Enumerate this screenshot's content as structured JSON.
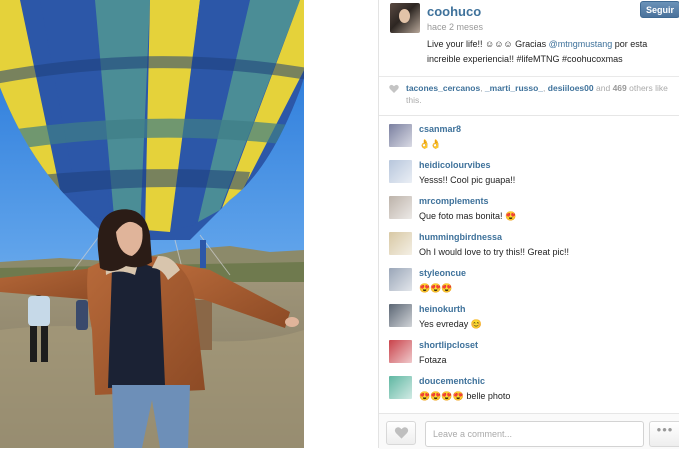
{
  "post": {
    "username": "coohuco",
    "time_ago": "hace 2 meses",
    "caption_before": "Live your life!! ☺☺☺ Gracias ",
    "caption_mention": "@mtngmustang",
    "caption_after": " por esta increible experiencia!! #lifeMTNG #coohucoxmas",
    "follow_label": "Seguir"
  },
  "likes": {
    "users": [
      "tacones_cercanos",
      "_marti_russo_",
      "desiiloes00"
    ],
    "and": "and",
    "count": "469",
    "suffix": "others like this."
  },
  "comments": [
    {
      "user": "csanmar8",
      "text": "👌👌",
      "avatar_color": "#7a7fa0"
    },
    {
      "user": "heidicolourvibes",
      "text": "Yesss!! Cool pic guapa!!",
      "avatar_color": "#b7c6dc"
    },
    {
      "user": "mrcomplements",
      "text": "Que foto mas bonita! 😍",
      "avatar_color": "#bdb3aa"
    },
    {
      "user": "hummingbirdnessa",
      "text": "Oh I would love to try this!! Great pic!!",
      "avatar_color": "#d8c8a4"
    },
    {
      "user": "styleoncue",
      "text": "😍😍😍",
      "avatar_color": "#9aa6b8"
    },
    {
      "user": "heinokurth",
      "text": "Yes evreday 😊",
      "avatar_color": "#5b6674"
    },
    {
      "user": "shortlipcloset",
      "text": "Fotaza",
      "avatar_color": "#c9424a"
    },
    {
      "user": "doucementchic",
      "text": "😍😍😍😍 belle photo",
      "avatar_color": "#5fb7a2"
    }
  ],
  "footer": {
    "comment_placeholder": "Leave a comment...",
    "more_label": "•••"
  },
  "colors": {
    "link": "#3f729b",
    "follow_button": "#4b729b"
  }
}
